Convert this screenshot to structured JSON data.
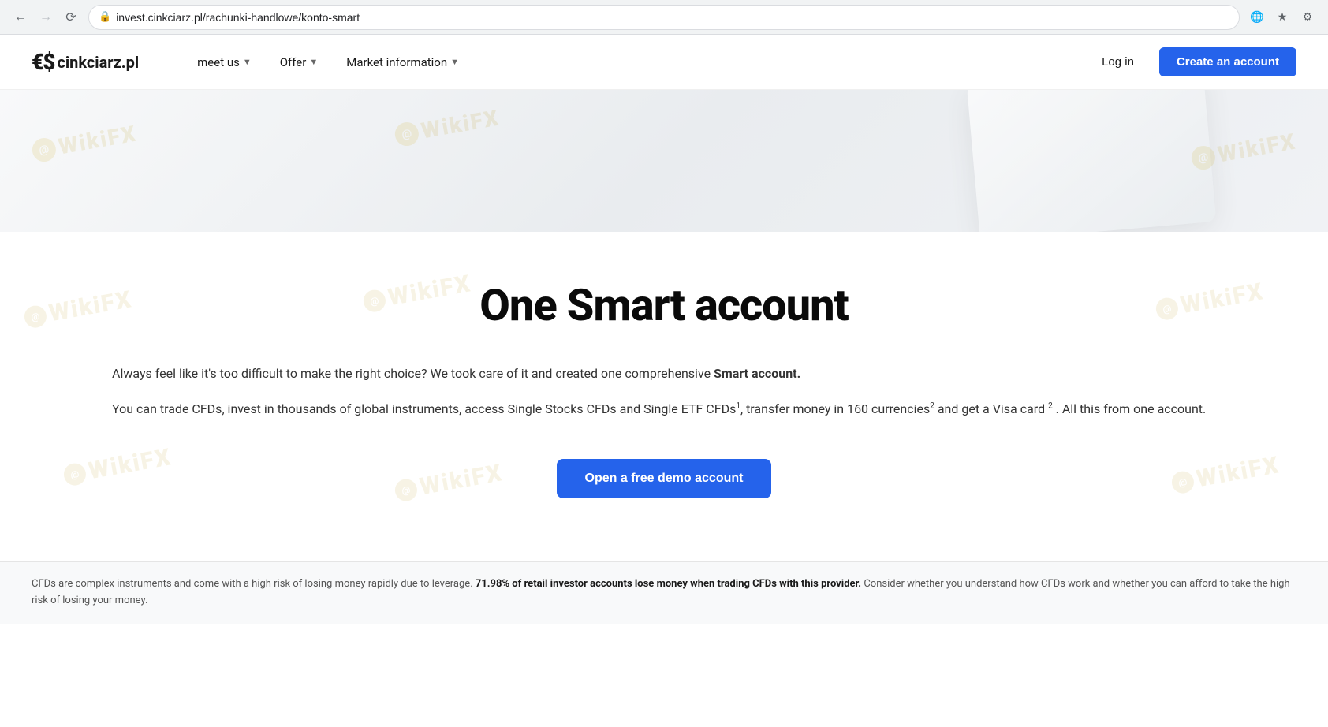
{
  "browser": {
    "url": "invest.cinkciarz.pl/rachunki-handlowe/konto-smart",
    "back_disabled": false,
    "forward_disabled": true
  },
  "navbar": {
    "logo_symbol": "€$",
    "logo_name": "cinkciarz.pl",
    "nav_items": [
      {
        "label": "meet us",
        "has_dropdown": true
      },
      {
        "label": "Offer",
        "has_dropdown": true
      },
      {
        "label": "Market information",
        "has_dropdown": true
      }
    ],
    "login_label": "Log in",
    "create_account_label": "Create an account"
  },
  "main": {
    "title": "One Smart account",
    "description_1": "Always feel like it's too difficult to make the right choice? We took care of it and created one comprehensive",
    "description_1_strong": "Smart account.",
    "description_2": "You can trade CFDs, invest in thousands of global instruments, access Single Stocks CFDs and Single ETF CFDs",
    "description_2_sup1": "1",
    "description_2_mid": ", transfer money in 160 currencies",
    "description_2_sup2": "2",
    "description_2_end": "and get a Visa card",
    "description_2_sup3": "2",
    "description_2_tail": ". All this from one account.",
    "demo_button_label": "Open a free demo account"
  },
  "footer": {
    "disclaimer_prefix": "CFDs are complex instruments and come with a high risk of losing money rapidly due to leverage.",
    "disclaimer_bold": "71.98% of retail investor accounts lose money when trading CFDs with this provider.",
    "disclaimer_suffix": "Consider whether you understand how CFDs work and whether you can afford to take the high risk of losing your money."
  }
}
